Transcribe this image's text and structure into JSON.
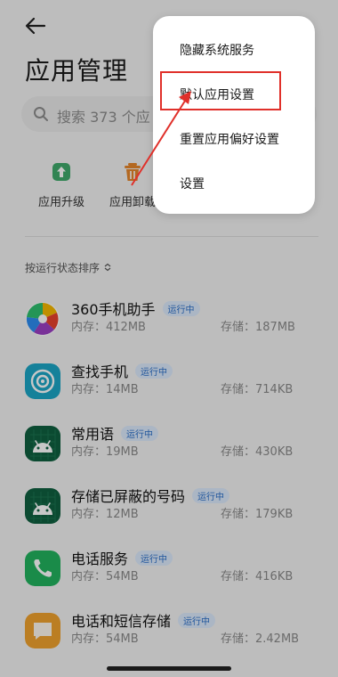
{
  "header": {
    "title": "应用管理"
  },
  "search": {
    "placeholder": "搜索 373 个应"
  },
  "quick_actions": [
    {
      "label": "应用升级",
      "icon": "upgrade-icon",
      "color": "#3fa96b"
    },
    {
      "label": "应用卸载",
      "icon": "trash-icon",
      "color": "#e6862b"
    }
  ],
  "sort": {
    "label": "按运行状态排序"
  },
  "apps": [
    {
      "name": "360手机助手",
      "status": "运行中",
      "memory": "内存：412MB",
      "storage": "存储：187MB",
      "icon": "360-assistant-icon"
    },
    {
      "name": "查找手机",
      "status": "运行中",
      "memory": "内存：14MB",
      "storage": "存储：714KB",
      "icon": "find-phone-icon"
    },
    {
      "name": "常用语",
      "status": "运行中",
      "memory": "内存：19MB",
      "storage": "存储：430KB",
      "icon": "android-icon"
    },
    {
      "name": "存储已屏蔽的号码",
      "status": "运行中",
      "memory": "内存：12MB",
      "storage": "存储：179KB",
      "icon": "android-icon"
    },
    {
      "name": "电话服务",
      "status": "运行中",
      "memory": "内存：54MB",
      "storage": "存储：416KB",
      "icon": "phone-icon"
    },
    {
      "name": "电话和短信存储",
      "status": "运行中",
      "memory": "内存：54MB",
      "storage": "存储：2.42MB",
      "icon": "sms-storage-icon"
    }
  ],
  "popup_menu": {
    "items": [
      {
        "label": "隐藏系统服务"
      },
      {
        "label": "默认应用设置"
      },
      {
        "label": "重置应用偏好设置"
      },
      {
        "label": "设置"
      }
    ]
  },
  "colors": {
    "highlight": "#e0302a",
    "badge_text": "#2a6fc9",
    "badge_bg": "#dce9fb"
  }
}
